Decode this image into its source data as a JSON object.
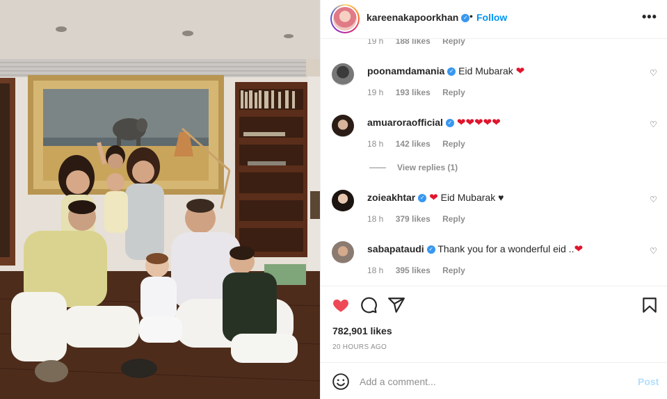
{
  "post": {
    "author": "kareenakapoorkhan",
    "dot": "•",
    "follow_label": "Follow",
    "more_icon": "more-horizontal-icon",
    "verified_icon": "verified-badge-icon"
  },
  "partial_comment": {
    "time": "19 h",
    "likes": "188 likes",
    "reply": "Reply"
  },
  "comments": [
    {
      "user": "poonamdamania",
      "text": "Eid Mubarak ",
      "emoji": "❤",
      "time": "19 h",
      "likes": "193 likes",
      "reply": "Reply"
    },
    {
      "user": "amuaroraofficial",
      "text": "",
      "emoji": "❤❤❤❤❤",
      "time": "18 h",
      "likes": "142 likes",
      "reply": "Reply"
    },
    {
      "user": "zoieakhtar",
      "text": "Eid Mubarak ♥",
      "emoji": "❤",
      "time": "18 h",
      "likes": "379 likes",
      "reply": "Reply"
    },
    {
      "user": "sabapataudi",
      "text": "Thank you for a wonderful eid ..",
      "emoji": "❤",
      "time": "18 h",
      "likes": "395 likes",
      "reply": "Reply"
    }
  ],
  "view_replies": "View replies (1)",
  "actions": {
    "like_icon": "heart-filled-icon",
    "comment_icon": "comment-icon",
    "share_icon": "paper-plane-icon",
    "save_icon": "bookmark-icon",
    "likes_count": "782,901 likes",
    "time_ago": "20 HOURS AGO",
    "like_color": "#ed4956"
  },
  "add_comment": {
    "placeholder": "Add a comment...",
    "post_label": "Post",
    "emoji_icon": "smiley-icon"
  },
  "colors": {
    "accent": "#0095f6",
    "muted": "#8e8e8e",
    "heart": "#e0142c"
  }
}
